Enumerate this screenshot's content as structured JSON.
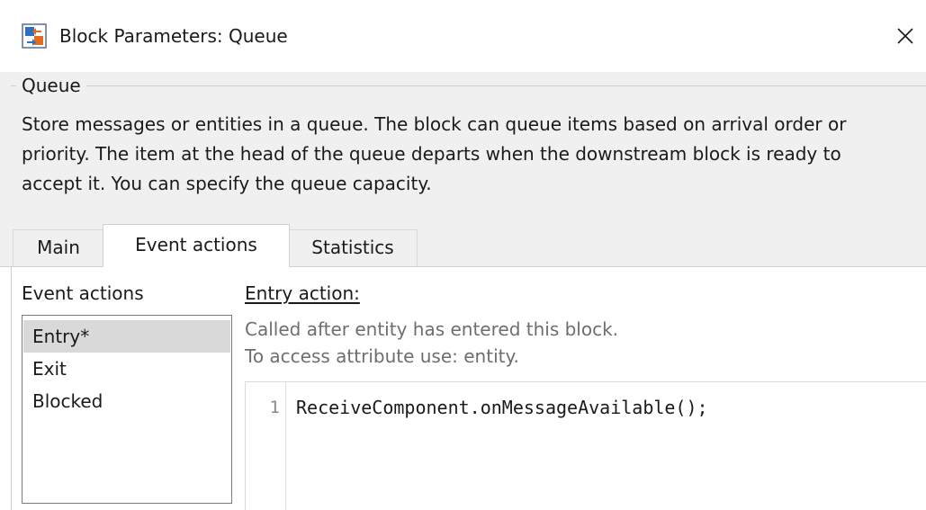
{
  "window": {
    "title": "Block Parameters: Queue",
    "icon": "simulink-block-icon",
    "close_icon": "close-icon"
  },
  "group": {
    "title": "Queue",
    "description": "Store messages or entities in a queue. The block can queue items based on arrival order or priority. The item at the head of the queue departs when the downstream block is ready to accept it. You can specify the queue capacity."
  },
  "tabs": [
    {
      "label": "Main",
      "active": false
    },
    {
      "label": "Event actions",
      "active": true
    },
    {
      "label": "Statistics",
      "active": false
    }
  ],
  "event_actions": {
    "label": "Event actions",
    "items": [
      {
        "label": "Entry*",
        "selected": true
      },
      {
        "label": "Exit",
        "selected": false
      },
      {
        "label": "Blocked",
        "selected": false
      }
    ]
  },
  "entry_action": {
    "title": "Entry action:",
    "hint_1": "Called after entity has entered this block.",
    "hint_2": "To access attribute use: entity.",
    "code_lines": [
      {
        "number": "1",
        "text": "ReceiveComponent.onMessageAvailable();"
      }
    ]
  },
  "colors": {
    "panel_background": "#f0f0f0",
    "selected_item": "#d9d9d9",
    "hint_text": "#6e6e6e"
  }
}
